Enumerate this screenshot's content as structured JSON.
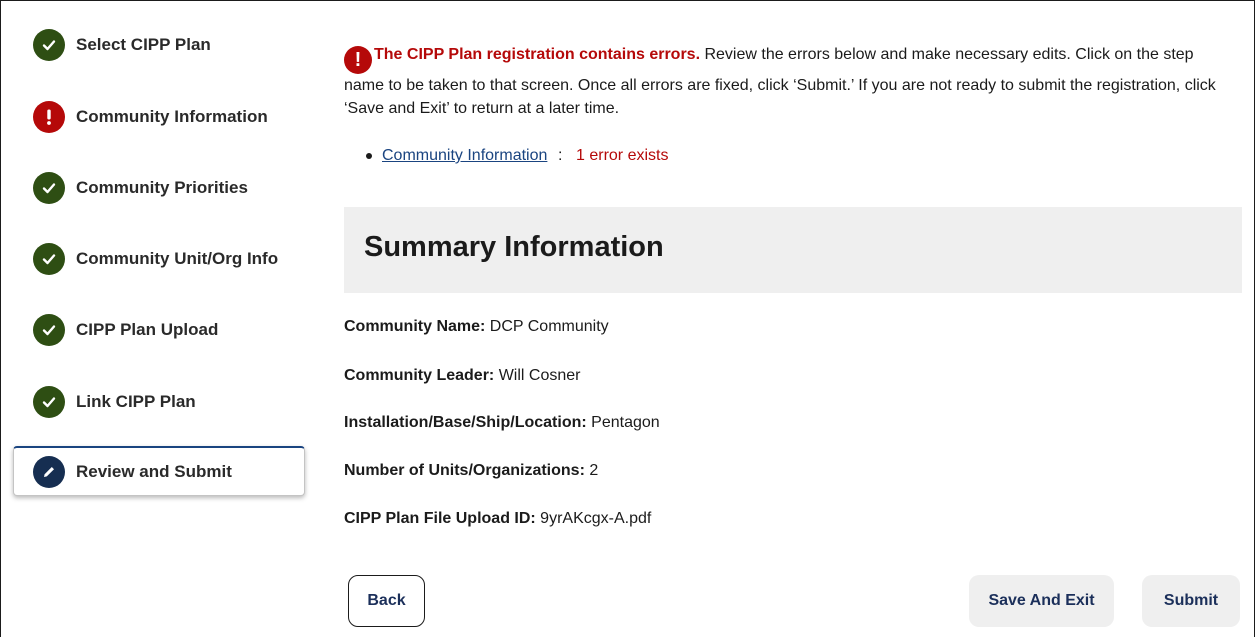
{
  "sidebar": {
    "steps": [
      {
        "label": "Select CIPP Plan",
        "status": "complete",
        "icon": "check-icon"
      },
      {
        "label": "Community Information",
        "status": "error",
        "icon": "exclamation-icon"
      },
      {
        "label": "Community Priorities",
        "status": "complete",
        "icon": "check-icon"
      },
      {
        "label": "Community Unit/Org Info",
        "status": "complete",
        "icon": "check-icon"
      },
      {
        "label": "CIPP Plan Upload",
        "status": "complete",
        "icon": "check-icon"
      },
      {
        "label": "Link CIPP Plan",
        "status": "complete",
        "icon": "check-icon"
      },
      {
        "label": "Review and Submit",
        "status": "current",
        "icon": "pencil-icon"
      }
    ]
  },
  "alert": {
    "icon": "!",
    "heading": "The CIPP Plan registration contains errors.",
    "body": " Review the errors below and make necessary edits. Click on the step name to be taken to that screen. Once all errors are fixed, click ‘Submit.’ If you are not ready to submit the registration, click ‘Save and Exit’ to return at a later time.",
    "errors": [
      {
        "link": "Community Information",
        "separator": " : ",
        "message": "1 error exists"
      }
    ]
  },
  "summary": {
    "title": "Summary Information",
    "fields": [
      {
        "label": "Community Name:",
        "value": " DCP Community"
      },
      {
        "label": "Community Leader:",
        "value": " Will Cosner"
      },
      {
        "label": "Installation/Base/Ship/Location:",
        "value": " Pentagon"
      },
      {
        "label": "Number of Units/Organizations:",
        "value": " 2"
      },
      {
        "label": "CIPP Plan File Upload ID:",
        "value": " 9yrAKcgx-A.pdf"
      }
    ]
  },
  "buttons": {
    "back": "Back",
    "save_exit": "Save And Exit",
    "submit": "Submit"
  },
  "colors": {
    "complete": "#2e4e13",
    "error": "#b50909",
    "current": "#162e51",
    "link": "#1a4480"
  }
}
